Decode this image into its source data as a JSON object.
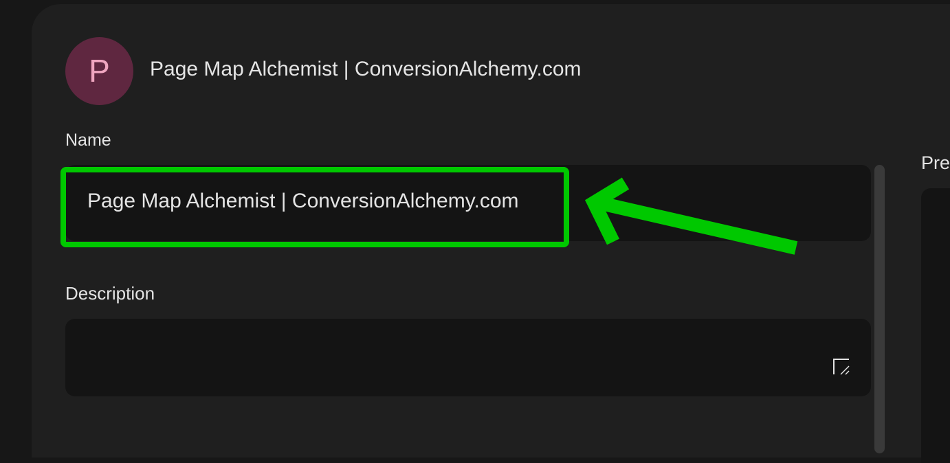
{
  "header": {
    "avatar_letter": "P",
    "title": "Page Map Alchemist | ConversionAlchemy.com"
  },
  "form": {
    "name_label": "Name",
    "name_value": "Page Map Alchemist | ConversionAlchemy.com",
    "description_label": "Description",
    "description_value": ""
  },
  "preview": {
    "label": "Pre"
  },
  "annotation": {
    "color": "#00c800",
    "type": "arrow-and-box highlight"
  },
  "icons": {
    "resize": "textarea-resize-icon"
  }
}
